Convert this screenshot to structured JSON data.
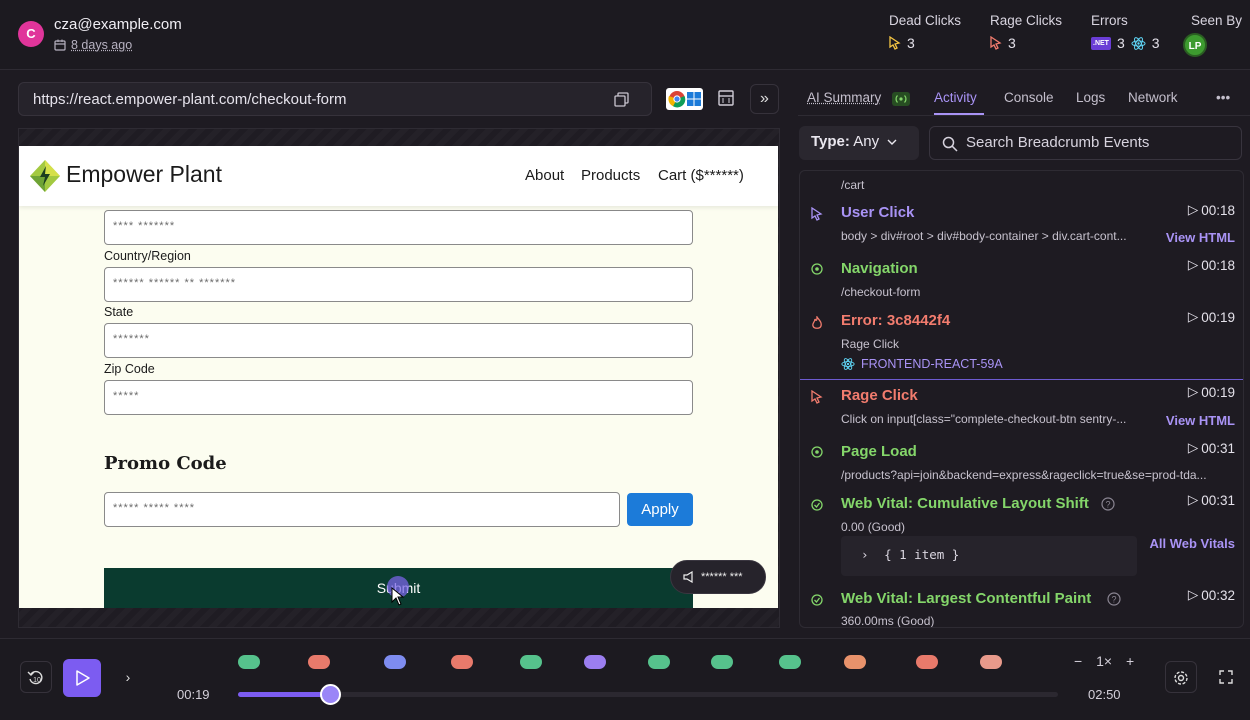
{
  "session": {
    "avatar_letter": "C",
    "email": "cza@example.com",
    "time_ago": "8 days ago"
  },
  "stats": {
    "dead_clicks": {
      "label": "Dead Clicks",
      "value": "3"
    },
    "rage_clicks": {
      "label": "Rage Clicks",
      "value": "3"
    },
    "errors": {
      "label": "Errors",
      "dotnet_value": "3",
      "react_value": "3",
      "dotnet_badge": ".NET"
    },
    "seen_by": {
      "label": "Seen By",
      "initials": "LP"
    }
  },
  "replay": {
    "url": "https://react.empower-plant.com/checkout-form"
  },
  "site": {
    "brand": "Empower Plant",
    "nav": [
      "About",
      "Products",
      "Cart ($******)"
    ],
    "field_1_value": "**** *******",
    "country_label": "Country/Region",
    "country_value": "****** ****** ** *******",
    "state_label": "State",
    "state_value": "*******",
    "zip_label": "Zip Code",
    "zip_value": "*****",
    "promo_title": "Promo Code",
    "promo_value": "***** ***** ****",
    "apply_label": "Apply",
    "submit_label": "Submit",
    "overlay_text": "****** ***"
  },
  "tabs": {
    "ai_summary": "AI Summary",
    "activity": "Activity",
    "console": "Console",
    "logs": "Logs",
    "network": "Network",
    "more": "•••"
  },
  "filter": {
    "type_label": "Type:",
    "type_value": "Any",
    "search_placeholder": "Search Breadcrumb Events"
  },
  "events": [
    {
      "title": "",
      "sub": "/cart",
      "time": ""
    },
    {
      "title": "User Click",
      "sub": "body > div#root > div#body-container > div.cart-cont...",
      "time": "00:18",
      "link": "View HTML"
    },
    {
      "title": "Navigation",
      "sub": "/checkout-form",
      "time": "00:18"
    },
    {
      "title": "Error: 3c8442f4",
      "sub": "Rage Click",
      "issue": "FRONTEND-REACT-59A",
      "time": "00:19"
    },
    {
      "title": "Rage Click",
      "sub": "Click on input[class=\"complete-checkout-btn sentry-...",
      "time": "00:19",
      "link": "View HTML"
    },
    {
      "title": "Page Load",
      "sub": "/products?api=join&backend=express&rageclick=true&se=prod-tda...",
      "time": "00:31"
    },
    {
      "title": "Web Vital: Cumulative Layout Shift",
      "sub": "0.00 (Good)",
      "json": "{ 1 item }",
      "time": "00:31",
      "link": "All Web Vitals"
    },
    {
      "title": "Web Vital: Largest Contentful Paint",
      "sub": "360.00ms (Good)",
      "time": "00:32"
    }
  ],
  "playback": {
    "current": "00:19",
    "duration": "02:50",
    "speed": "1×",
    "progress_fraction": 0.112,
    "skip_label": "10"
  },
  "colors": {
    "accent": "#7c5cf1",
    "green": "#84d66a",
    "red": "#f27c6e"
  }
}
